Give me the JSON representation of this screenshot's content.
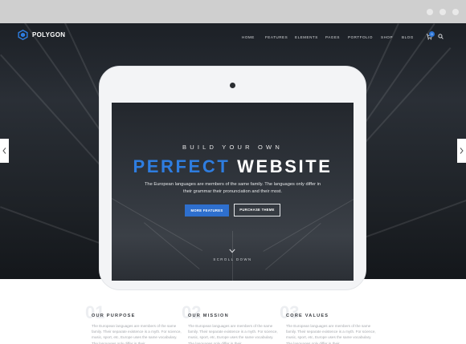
{
  "brand": {
    "name": "POLYGON",
    "accent": "#2e7de0"
  },
  "nav": {
    "items": [
      "HOME",
      "FEATURES",
      "ELEMENTS",
      "PAGES",
      "PORTFOLIO",
      "SHOP",
      "BLOG"
    ],
    "cart_count": "0",
    "icons": {
      "cart": "cart-icon",
      "search": "search-icon"
    }
  },
  "hero": {
    "eyebrow": "BUILD YOUR OWN",
    "headline_accent": "PERFECT",
    "headline_rest": "WEBSITE",
    "description": "The European languages are members of the same family. The languages only differ in their grammar their pronunciation and their most.",
    "primary_button": "MORE FEATURES",
    "secondary_button": "PURCHASE THEME",
    "scroll_label": "SCROLL DOWN"
  },
  "features": [
    {
      "number": "01",
      "title": "OUR PURPOSE",
      "body": "The European languages are members of the same family. Their separate existence is a myth. For science, music, sport, etc, Europe uses the same vocabulary. The languages only differ in their"
    },
    {
      "number": "02",
      "title": "OUR MISSION",
      "body": "The European languages are members of the same family. Their separate existence is a myth. For science, music, sport, etc, Europe uses the same vocabulary. The languages only differ in their"
    },
    {
      "number": "03",
      "title": "CORE VALUES",
      "body": "The European languages are members of the same family. Their separate existence is a myth. For science, music, sport, etc, Europe uses the same vocabulary. The languages only differ in their"
    }
  ]
}
